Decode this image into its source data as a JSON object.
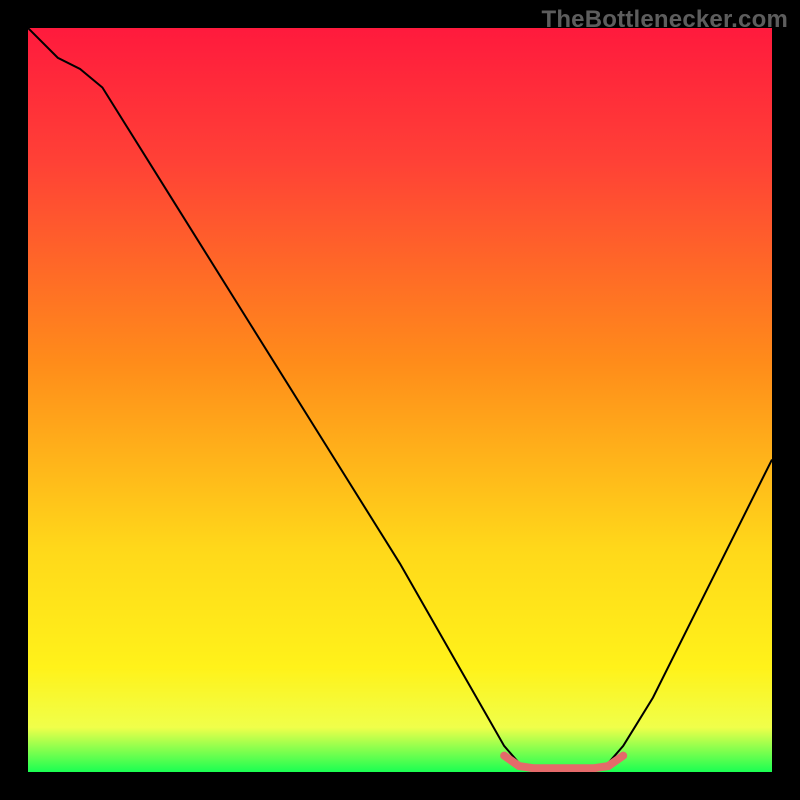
{
  "watermark": "TheBottlenecker.com",
  "chart_data": {
    "type": "line",
    "title": "",
    "xlabel": "",
    "ylabel": "",
    "xlim": [
      0,
      100
    ],
    "ylim": [
      0,
      100
    ],
    "gradient": {
      "stops": [
        {
          "offset": 0,
          "color": "#ff1a3d"
        },
        {
          "offset": 18,
          "color": "#ff4136"
        },
        {
          "offset": 45,
          "color": "#ff8c1a"
        },
        {
          "offset": 70,
          "color": "#ffd81a"
        },
        {
          "offset": 86,
          "color": "#fff21a"
        },
        {
          "offset": 94,
          "color": "#f0ff4a"
        },
        {
          "offset": 100,
          "color": "#1aff52"
        }
      ]
    },
    "series": [
      {
        "name": "bottleneck-curve",
        "color": "#000000",
        "stroke_width": 2,
        "points": [
          {
            "x": 0,
            "y": 100
          },
          {
            "x": 4,
            "y": 96
          },
          {
            "x": 7,
            "y": 94.5
          },
          {
            "x": 10,
            "y": 92
          },
          {
            "x": 20,
            "y": 76
          },
          {
            "x": 30,
            "y": 60
          },
          {
            "x": 40,
            "y": 44
          },
          {
            "x": 50,
            "y": 28
          },
          {
            "x": 58,
            "y": 14
          },
          {
            "x": 62,
            "y": 7
          },
          {
            "x": 64,
            "y": 3.5
          },
          {
            "x": 66,
            "y": 1.2
          },
          {
            "x": 68,
            "y": 0.5
          },
          {
            "x": 72,
            "y": 0.5
          },
          {
            "x": 76,
            "y": 0.5
          },
          {
            "x": 78,
            "y": 1.2
          },
          {
            "x": 80,
            "y": 3.5
          },
          {
            "x": 84,
            "y": 10
          },
          {
            "x": 90,
            "y": 22
          },
          {
            "x": 96,
            "y": 34
          },
          {
            "x": 100,
            "y": 42
          }
        ]
      },
      {
        "name": "optimal-flat",
        "color": "#e46a6a",
        "stroke_width": 8,
        "linecap": "round",
        "points": [
          {
            "x": 64,
            "y": 2.2
          },
          {
            "x": 66,
            "y": 0.8
          },
          {
            "x": 68,
            "y": 0.5
          },
          {
            "x": 72,
            "y": 0.5
          },
          {
            "x": 76,
            "y": 0.5
          },
          {
            "x": 78,
            "y": 0.8
          },
          {
            "x": 80,
            "y": 2.2
          }
        ]
      }
    ]
  }
}
